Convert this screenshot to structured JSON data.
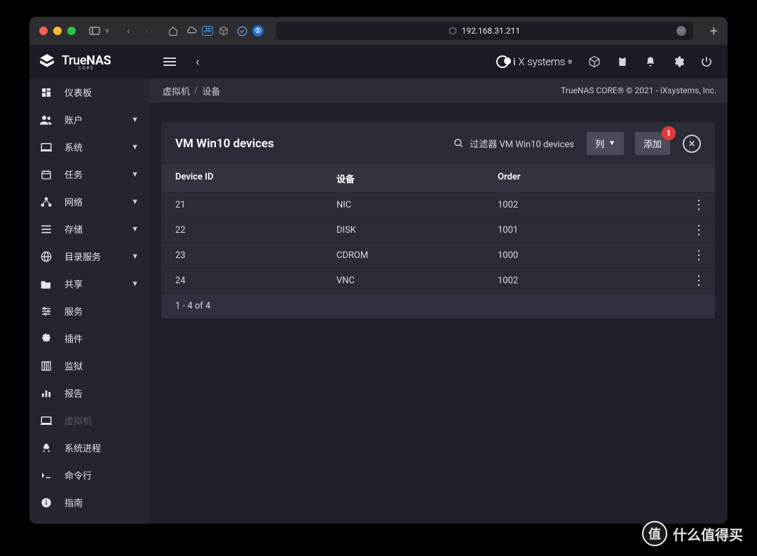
{
  "browser": {
    "url": "192.168.31.211"
  },
  "brand": {
    "name_prefix": "True",
    "name_bold": "NAS",
    "sub": "CORE"
  },
  "topbar": {
    "ixsystems": "systems"
  },
  "breadcrumb": {
    "a": "虚拟机",
    "b": "设备",
    "copyright": "TrueNAS CORE® © 2021 - iXsystems, Inc."
  },
  "sidebar": {
    "items": [
      {
        "label": "仪表板",
        "icon": "dashboard",
        "expandable": false
      },
      {
        "label": "账户",
        "icon": "people",
        "expandable": true
      },
      {
        "label": "系统",
        "icon": "laptop",
        "expandable": true
      },
      {
        "label": "任务",
        "icon": "calendar",
        "expandable": true
      },
      {
        "label": "网络",
        "icon": "network",
        "expandable": true
      },
      {
        "label": "存储",
        "icon": "list",
        "expandable": true
      },
      {
        "label": "目录服务",
        "icon": "globe",
        "expandable": true
      },
      {
        "label": "共享",
        "icon": "folder",
        "expandable": true
      },
      {
        "label": "服务",
        "icon": "tune",
        "expandable": false
      },
      {
        "label": "插件",
        "icon": "puzzle",
        "expandable": false
      },
      {
        "label": "监狱",
        "icon": "jail",
        "expandable": false
      },
      {
        "label": "报告",
        "icon": "bar",
        "expandable": false
      },
      {
        "label": "虚拟机",
        "icon": "laptop",
        "expandable": false,
        "dim": true
      },
      {
        "label": "系统进程",
        "icon": "rocket",
        "expandable": false
      },
      {
        "label": "命令行",
        "icon": "terminal",
        "expandable": false
      },
      {
        "label": "指南",
        "icon": "info",
        "expandable": false
      }
    ]
  },
  "card": {
    "title": "VM Win10 devices",
    "search_label": "过滤器 VM Win10 devices",
    "col_button": "列",
    "add_button": "添加",
    "add_badge": "1",
    "columns": {
      "c1": "Device ID",
      "c2": "设备",
      "c3": "Order"
    },
    "rows": [
      {
        "id": "21",
        "dev": "NIC",
        "order": "1002"
      },
      {
        "id": "22",
        "dev": "DISK",
        "order": "1001"
      },
      {
        "id": "23",
        "dev": "CDROM",
        "order": "1000"
      },
      {
        "id": "24",
        "dev": "VNC",
        "order": "1002"
      }
    ],
    "footer": "1 - 4 of 4"
  },
  "watermark": {
    "text": "什么值得买"
  }
}
